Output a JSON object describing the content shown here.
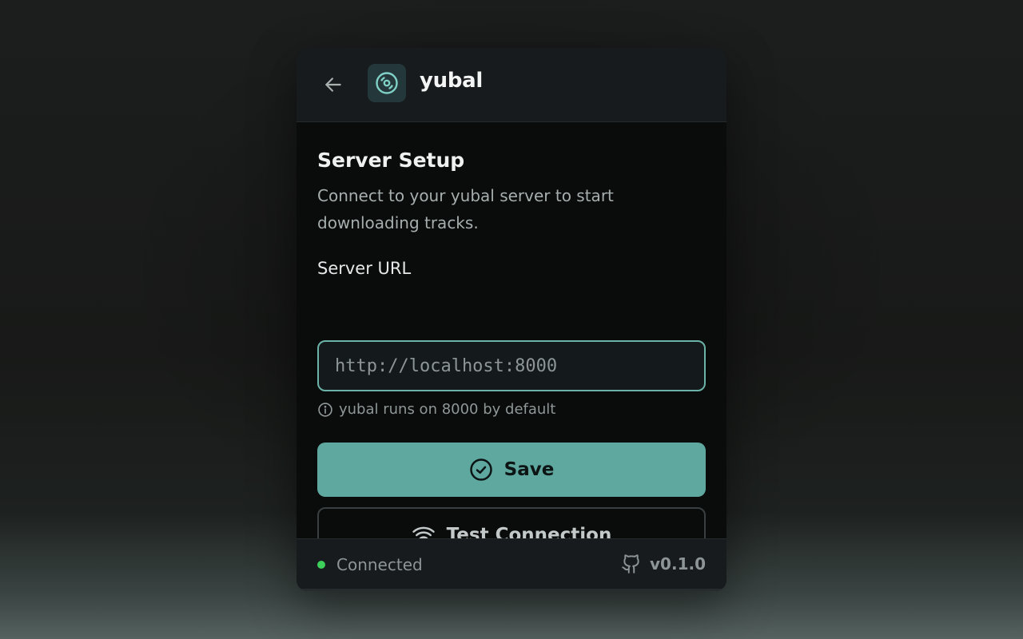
{
  "header": {
    "app_name": "yubal",
    "back_icon": "arrow-left-icon",
    "logo_icon": "disc-icon"
  },
  "setup": {
    "title": "Server Setup",
    "description": "Connect to your yubal server to start downloading tracks.",
    "field_label": "Server URL",
    "url_value": "",
    "url_placeholder": "http://localhost:8000",
    "hint": "yubal runs on 8000 by default",
    "hint_icon": "info-icon"
  },
  "actions": {
    "save_label": "Save",
    "save_icon": "check-circle-icon",
    "test_label": "Test Connection",
    "test_icon": "wifi-icon"
  },
  "footer": {
    "status": "Connected",
    "status_color": "#3ecf5a",
    "github_icon": "github-icon",
    "version": "v0.1.0"
  },
  "colors": {
    "accent": "#5fa8a0",
    "input_border": "#6bb2a8"
  }
}
